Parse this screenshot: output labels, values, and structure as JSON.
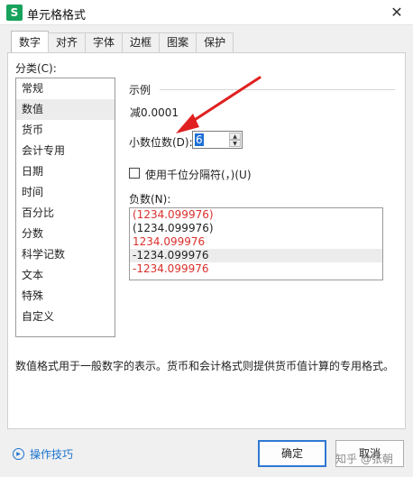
{
  "window": {
    "app_icon": "S",
    "title": "单元格格式",
    "close_glyph": "✕"
  },
  "tabs": [
    {
      "label": "数字",
      "active": true
    },
    {
      "label": "对齐"
    },
    {
      "label": "字体"
    },
    {
      "label": "边框"
    },
    {
      "label": "图案"
    },
    {
      "label": "保护"
    }
  ],
  "category": {
    "label": "分类(C):",
    "items": [
      "常规",
      "数值",
      "货币",
      "会计专用",
      "日期",
      "时间",
      "百分比",
      "分数",
      "科学记数",
      "文本",
      "特殊",
      "自定义"
    ],
    "selected": "数值"
  },
  "sample": {
    "label": "示例",
    "value": "减0.0001"
  },
  "decimal": {
    "label": "小数位数(D):",
    "value": "6"
  },
  "thousand_separator": {
    "label": "使用千位分隔符(，)(U)",
    "checked": false
  },
  "negative": {
    "label": "负数(N):",
    "items": [
      {
        "text": "(1234.099976)",
        "color": "#d9302c"
      },
      {
        "text": "(1234.099976)",
        "color": "#222222"
      },
      {
        "text": "1234.099976",
        "color": "#d9302c"
      },
      {
        "text": "-1234.099976",
        "color": "#222222"
      },
      {
        "text": "-1234.099976",
        "color": "#d9302c"
      }
    ],
    "selected_index": 3
  },
  "description": "数值格式用于一般数字的表示。货币和会计格式则提供货币值计算的专用格式。",
  "footer": {
    "tips_label": "操作技巧",
    "ok_label": "确定",
    "cancel_label": "取消",
    "watermark": "知乎 @张朝"
  },
  "colors": {
    "accent": "#2f78d4",
    "annotation_arrow": "#e02020",
    "selection": "#1e6fd9"
  }
}
